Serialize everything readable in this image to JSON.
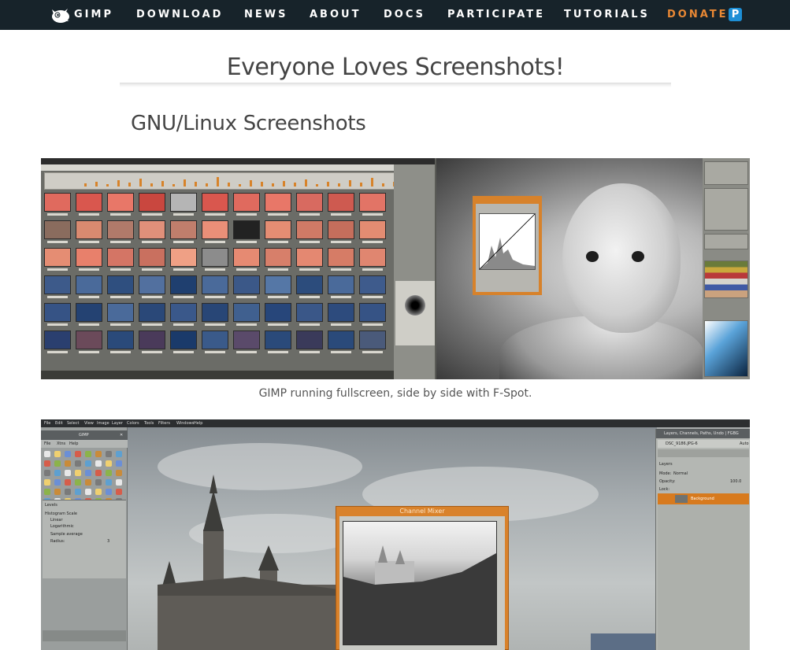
{
  "nav": {
    "logo_label": "GIMP",
    "items": [
      "DOWNLOAD",
      "NEWS",
      "ABOUT",
      "DOCS",
      "PARTICIPATE",
      "TUTORIALS",
      "DONATE"
    ],
    "donate_badge": "P",
    "accent": "#e98834",
    "background": "#17232a"
  },
  "page": {
    "title": "Everyone Loves Screenshots!",
    "section_title": "GNU/Linux Screenshots"
  },
  "screenshots": [
    {
      "alt": "GIMP running fullscreen, side by side with F-Spot.",
      "caption": "GIMP running fullscreen, side by side with F-Spot."
    },
    {
      "window_menus": [
        "File",
        "Edit",
        "Select",
        "View",
        "Image",
        "Layer",
        "Colors",
        "Tools",
        "Filters",
        "Windows",
        "Help"
      ],
      "toolbox_title": "GIMP",
      "toolbox_menus": [
        "File",
        "Xtns",
        "Help"
      ],
      "levels_label": "Levels",
      "histogram_scale_label": "Histogram Scale",
      "scale_options": [
        "Linear",
        "Logarithmic"
      ],
      "sample_average_label": "Sample average",
      "radius_label": "Radius:",
      "radius_value": "3",
      "dialog_title": "Channel Mixer",
      "dock_title": "Layers, Channels, Paths, Undo | FGBG",
      "image_name": "DSC_9186.JPG-6",
      "auto_label": "Auto",
      "layers_label": "Layers",
      "mode_label": "Mode:",
      "mode_value": "Normal",
      "opacity_label": "Opacity:",
      "opacity_value": "100.0",
      "lock_label": "Lock:",
      "layer_name": "Background"
    }
  ]
}
